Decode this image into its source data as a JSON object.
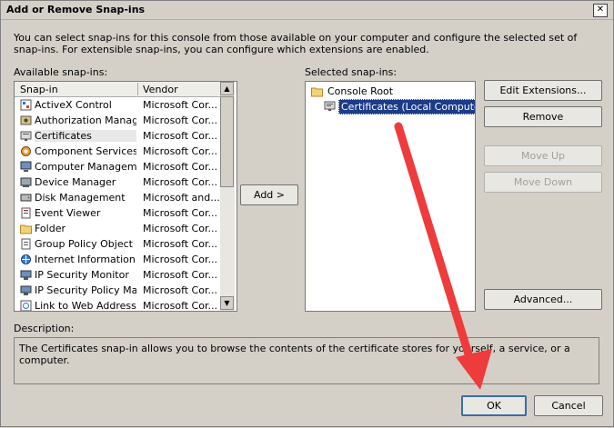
{
  "window": {
    "title": "Add or Remove Snap-ins",
    "close_glyph": "✕"
  },
  "intro_text": "You can select snap-ins for this console from those available on your computer and configure the selected set of snap-ins. For extensible snap-ins, you can configure which extensions are enabled.",
  "available": {
    "label": "Available snap-ins:",
    "columns": [
      "Snap-in",
      "Vendor"
    ],
    "rows": [
      {
        "name": "ActiveX Control",
        "vendor": "Microsoft Cor...",
        "icon": "activex-icon"
      },
      {
        "name": "Authorization Manager",
        "vendor": "Microsoft Cor...",
        "icon": "authorization-icon"
      },
      {
        "name": "Certificates",
        "vendor": "Microsoft Cor...",
        "icon": "certificate-icon"
      },
      {
        "name": "Component Services",
        "vendor": "Microsoft Cor...",
        "icon": "component-icon"
      },
      {
        "name": "Computer Managem...",
        "vendor": "Microsoft Cor...",
        "icon": "computer-icon"
      },
      {
        "name": "Device Manager",
        "vendor": "Microsoft Cor...",
        "icon": "device-icon"
      },
      {
        "name": "Disk Management",
        "vendor": "Microsoft and...",
        "icon": "disk-icon"
      },
      {
        "name": "Event Viewer",
        "vendor": "Microsoft Cor...",
        "icon": "event-icon"
      },
      {
        "name": "Folder",
        "vendor": "Microsoft Cor...",
        "icon": "folder-icon"
      },
      {
        "name": "Group Policy Object ...",
        "vendor": "Microsoft Cor...",
        "icon": "policy-icon"
      },
      {
        "name": "Internet Information...",
        "vendor": "Microsoft Cor...",
        "icon": "iis-icon"
      },
      {
        "name": "IP Security Monitor",
        "vendor": "Microsoft Cor...",
        "icon": "ipsec-icon"
      },
      {
        "name": "IP Security Policy Ma...",
        "vendor": "Microsoft Cor...",
        "icon": "ipsec-icon"
      },
      {
        "name": "Link to Web Address",
        "vendor": "Microsoft Cor...",
        "icon": "link-icon"
      }
    ]
  },
  "add_button": "Add >",
  "selected": {
    "label": "Selected snap-ins:",
    "root": "Console Root",
    "child": "Certificates (Local Computer)"
  },
  "buttons": {
    "edit_extensions": "Edit Extensions...",
    "remove": "Remove",
    "move_up": "Move Up",
    "move_down": "Move Down",
    "advanced": "Advanced...",
    "ok": "OK",
    "cancel": "Cancel"
  },
  "description": {
    "label": "Description:",
    "text": "The Certificates snap-in allows you to browse the contents of the certificate stores for yourself, a service, or a computer."
  },
  "colors": {
    "arrow": "#ee3b3b",
    "selection": "#1c3b8a"
  }
}
